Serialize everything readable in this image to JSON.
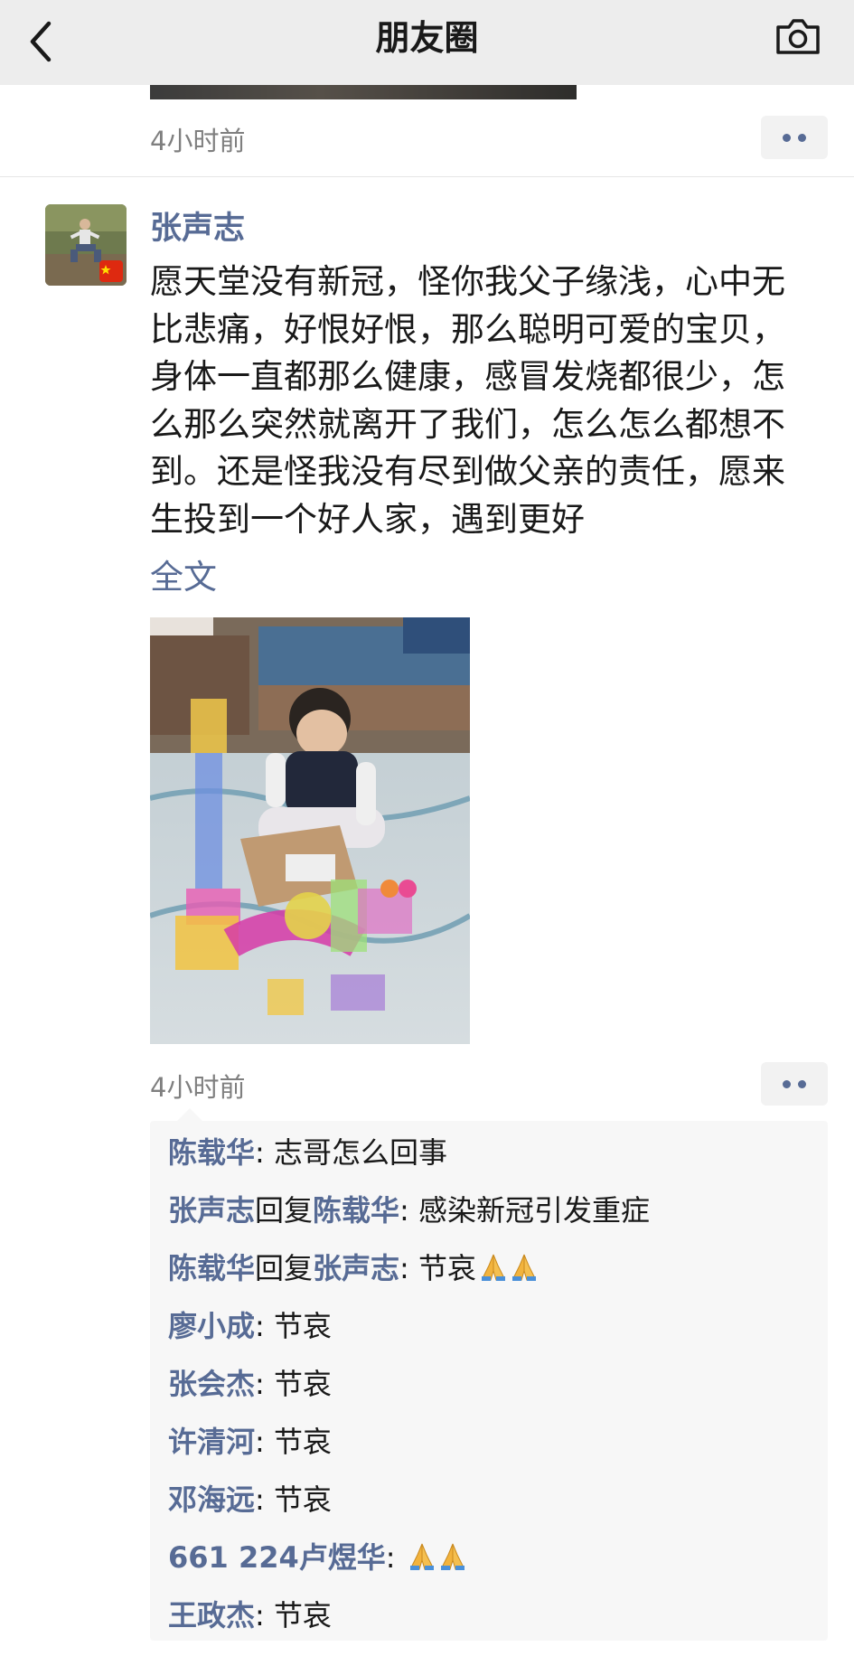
{
  "nav": {
    "title": "朋友圈",
    "back_icon": "chevron-left-icon",
    "camera_icon": "camera-icon"
  },
  "previous_post": {
    "time": "4小时前"
  },
  "post": {
    "author": "张声志",
    "text": "愿天堂没有新冠，怪你我父子缘浅，心中无比悲痛，好恨好恨，那么聪明可爱的宝贝，身体一直都那么健康，感冒发烧都很少，怎么那么突然就离开了我们，怎么怎么都想不到。还是怪我没有尽到做父亲的责任，愿来生投到一个好人家，遇到更好",
    "fulltext_link": "全文",
    "time": "4小时前",
    "avatar_badge_icon": "china-flag-icon",
    "photo_desc_icon": "photo-icon"
  },
  "comments": [
    {
      "name": "陈载华",
      "reply_word": "",
      "target": "",
      "text": ": 志哥怎么回事",
      "prayers": 0
    },
    {
      "name": "张声志",
      "reply_word": "回复",
      "target": "陈载华",
      "text": ": 感染新冠引发重症",
      "prayers": 0
    },
    {
      "name": "陈载华",
      "reply_word": "回复",
      "target": "张声志",
      "text": ": 节哀",
      "prayers": 2
    },
    {
      "name": "廖小成",
      "reply_word": "",
      "target": "",
      "text": ": 节哀",
      "prayers": 0
    },
    {
      "name": "张会杰",
      "reply_word": "",
      "target": "",
      "text": ": 节哀",
      "prayers": 0
    },
    {
      "name": "许清河",
      "reply_word": "",
      "target": "",
      "text": ": 节哀",
      "prayers": 0
    },
    {
      "name": "邓海远",
      "reply_word": "",
      "target": "",
      "text": ": 节哀",
      "prayers": 0
    },
    {
      "name": "661 224卢煜华",
      "reply_word": "",
      "target": "",
      "text": ": ",
      "prayers": 2
    },
    {
      "name": "王政杰",
      "reply_word": "",
      "target": "",
      "text": ": 节哀",
      "prayers": 0
    }
  ],
  "colors": {
    "link_blue": "#576b95",
    "nav_bg": "#ededed",
    "comment_bg": "#f7f7f7",
    "time_gray": "#7f7f7f"
  }
}
